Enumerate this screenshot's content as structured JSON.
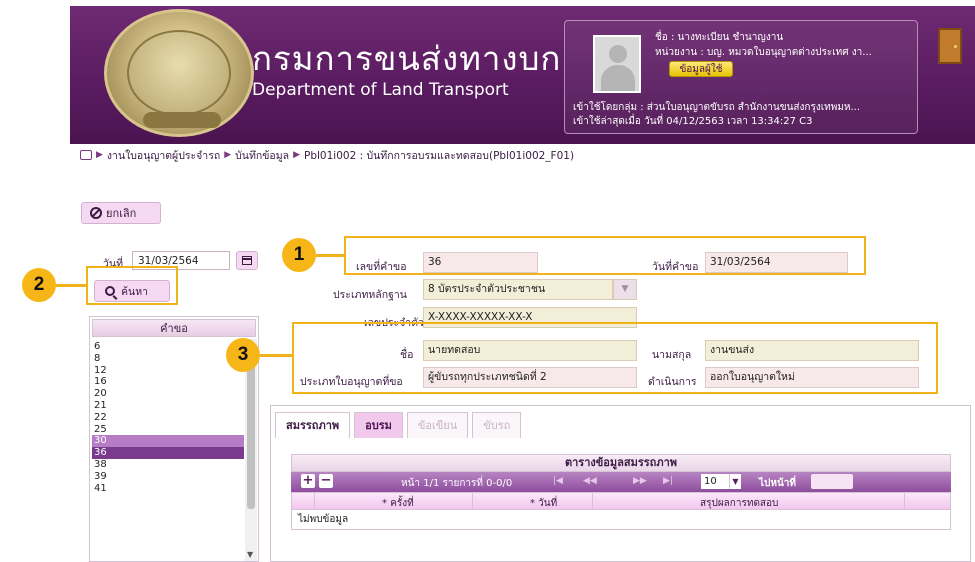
{
  "header": {
    "brand_th": "กรมการขนส่งทางบก",
    "brand_en": "Department of Land Transport",
    "user": {
      "name": "ชื่อ : นางทะเบียน ชำนาญงาน",
      "dept": "หน่วยงาน : บญ. หมวดใบอนุญาตต่างประเทศ งา...",
      "info_button": "ข้อมูลผู้ใช้",
      "group": "เข้าใช้โดยกลุ่ม : ส่วนใบอนุญาตขับรถ สำนักงานขนส่งกรุงเทพมห...",
      "last_login": "เข้าใช้ล่าสุดเมื่อ วันที่ 04/12/2563 เวลา 13:34:27 C3"
    }
  },
  "breadcrumb": {
    "items": [
      "งานใบอนุญาตผู้ประจำรถ",
      "บันทึกข้อมูล",
      "Pbl01i002 : บันทึกการอบรมและทดสอบ(Pbl01i002_F01)"
    ]
  },
  "toolbar": {
    "cancel_label": "ยกเลิก"
  },
  "left_panel": {
    "date_label": "วันที่",
    "date_value": "31/03/2564",
    "search_label": "ค้นหา",
    "list_header": "คำขอ",
    "list_items": [
      "6",
      "8",
      "12",
      "16",
      "20",
      "21",
      "22",
      "25",
      "30",
      "36",
      "38",
      "39",
      "41"
    ],
    "selected_light": "30",
    "selected_dark": "36"
  },
  "form": {
    "request_no_label": "เลขที่คำขอ",
    "request_no": "36",
    "request_date_label": "วันที่คำขอ",
    "request_date": "31/03/2564",
    "evidence_type_label": "ประเภทหลักฐาน",
    "evidence_type": "8 บัตรประจำตัวประชาชน",
    "id_no_label": "เลขประจำตัว",
    "id_no": "X-XXXX-XXXXX-XX-X",
    "first_name_label": "ชื่อ",
    "first_name": "นายทดสอบ",
    "last_name_label": "นามสกุล",
    "last_name": "งานขนส่ง",
    "license_type_label": "ประเภทใบอนุญาตที่ขอ",
    "license_type": "ผู้ขับรถทุกประเภทชนิดที่ 2",
    "action_label": "ดำเนินการ",
    "action": "ออกใบอนุญาตใหม่"
  },
  "callouts": {
    "one": "1",
    "two": "2",
    "three": "3"
  },
  "tabs": {
    "items": [
      "สมรรถภาพ",
      "อบรม",
      "ข้อเขียน",
      "ขับรถ"
    ]
  },
  "grid": {
    "title": "ตารางข้อมูลสมรรถภาพ",
    "page_info": "หน้า 1/1 รายการที่ 0-0/0",
    "per_page": "10",
    "goto_label": "ไปหน้าที่",
    "columns": [
      "* ครั้งที่",
      "* วันที่",
      "สรุปผลการทดสอบ"
    ],
    "empty_text": "ไม่พบข้อมูล"
  },
  "colors": {
    "header_purple": "#5b1c61",
    "callout_yellow": "#f7b617",
    "field_beige": "#f3eed8",
    "button_pink": "#f5d9f2"
  }
}
